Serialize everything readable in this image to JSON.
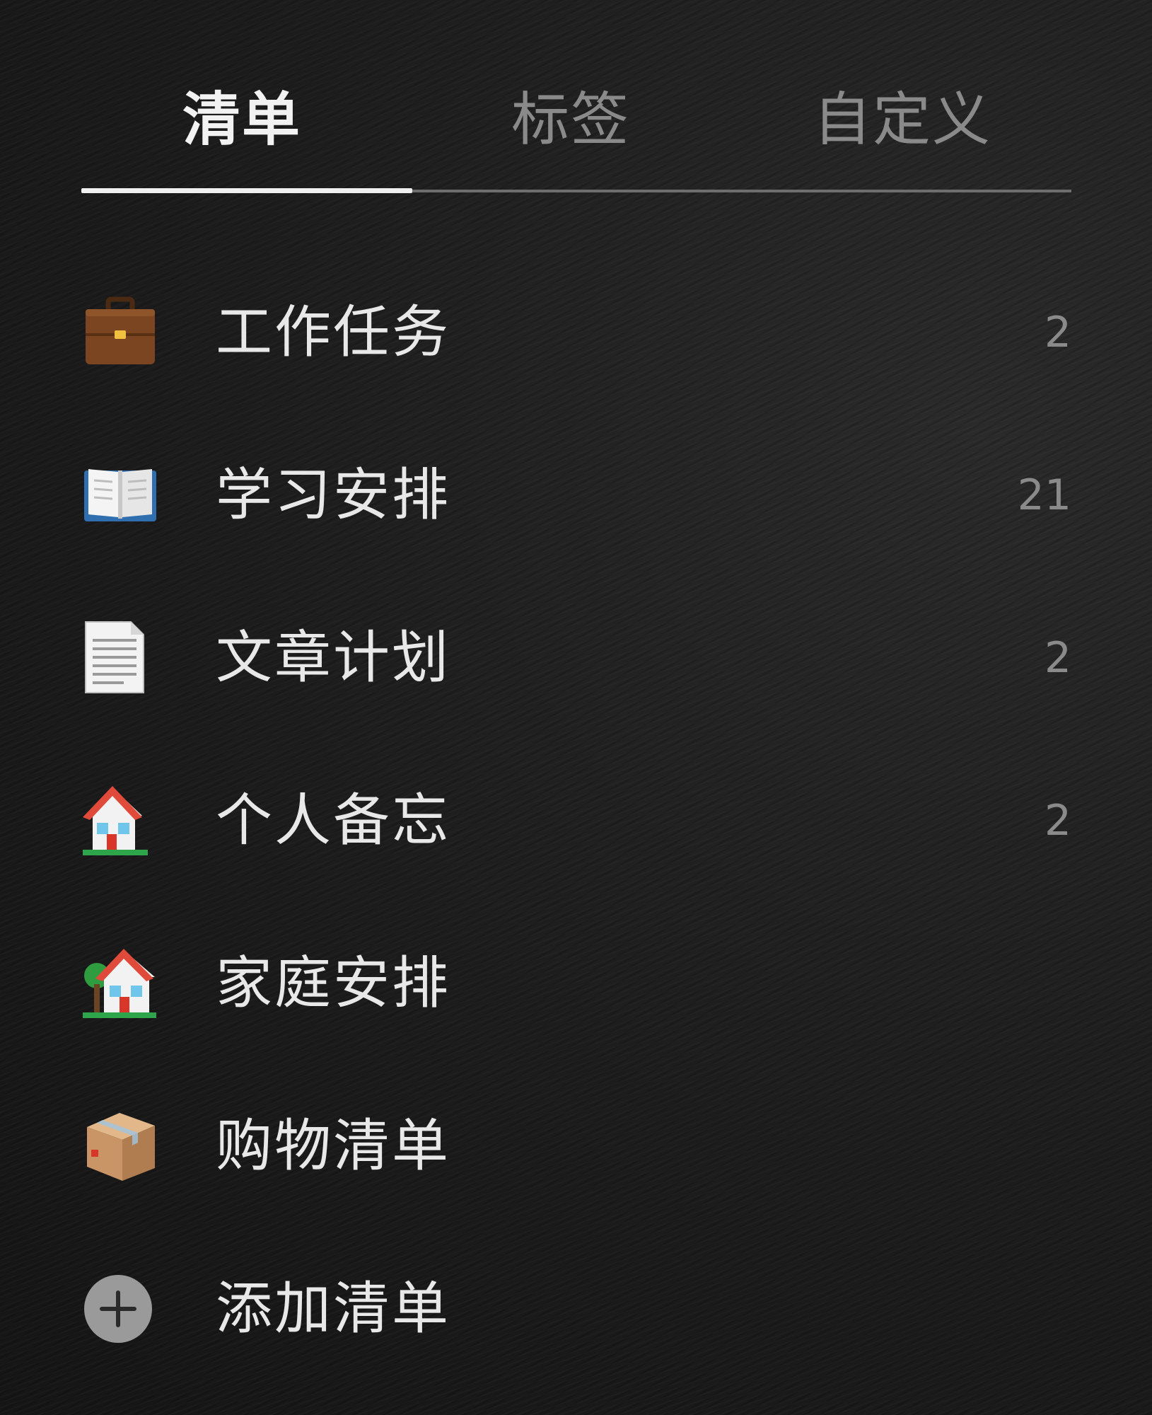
{
  "tabs": [
    {
      "label": "清单",
      "active": true
    },
    {
      "label": "标签",
      "active": false
    },
    {
      "label": "自定义",
      "active": false
    }
  ],
  "lists": [
    {
      "icon": "briefcase-icon",
      "label": "工作任务",
      "count": "2"
    },
    {
      "icon": "open-book-icon",
      "label": "学习安排",
      "count": "21"
    },
    {
      "icon": "document-icon",
      "label": "文章计划",
      "count": "2"
    },
    {
      "icon": "house-icon",
      "label": "个人备忘",
      "count": "2"
    },
    {
      "icon": "house-with-garden-icon",
      "label": "家庭安排",
      "count": ""
    },
    {
      "icon": "package-icon",
      "label": "购物清单",
      "count": ""
    }
  ],
  "add_list": {
    "icon": "plus-circle-icon",
    "label": "添加清单"
  },
  "colors": {
    "active_text": "#f2f2f2",
    "inactive_text": "#8a8a8a",
    "count_text": "#8a8a8a",
    "background": "#1c1c1c"
  }
}
